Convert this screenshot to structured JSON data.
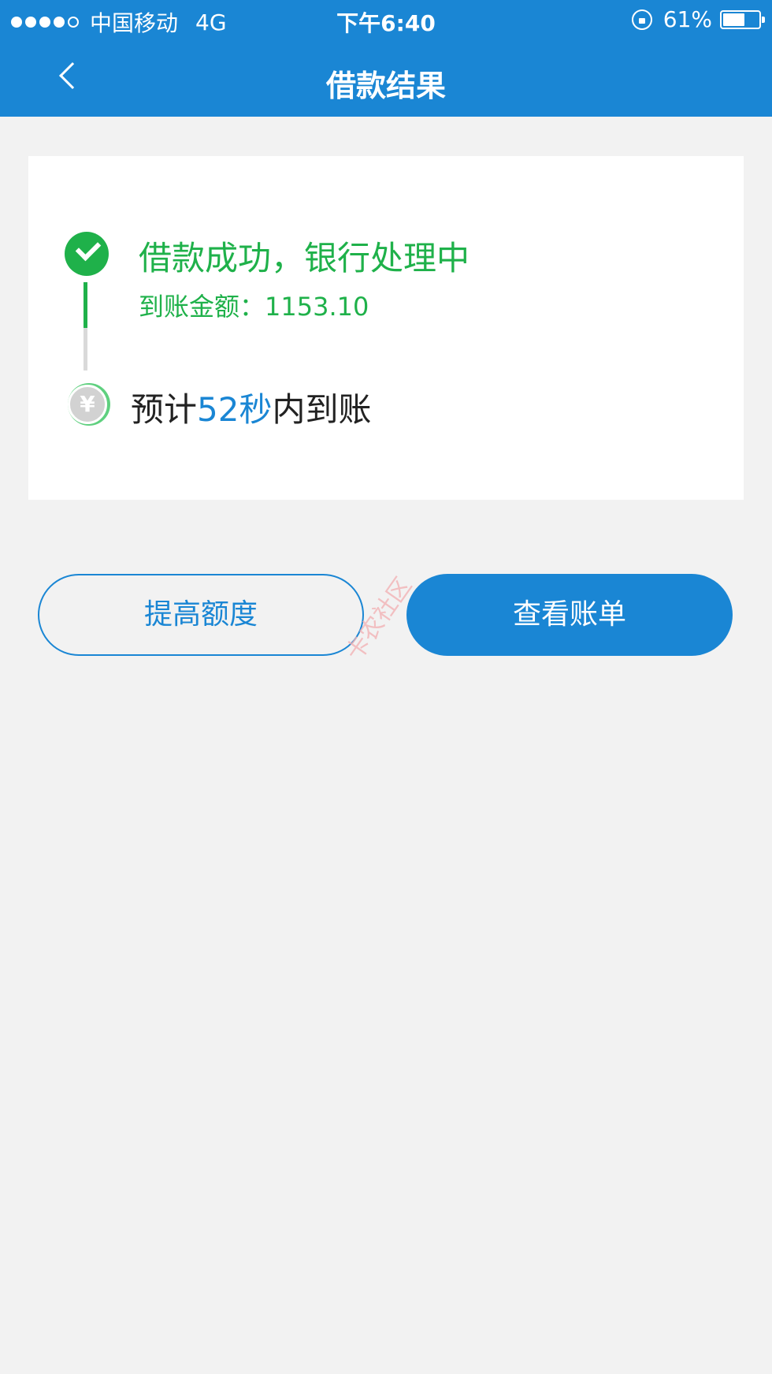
{
  "status_bar": {
    "carrier": "中国移动",
    "network": "4G",
    "time": "下午6:40",
    "battery": "61%",
    "battery_level": 0.61
  },
  "nav": {
    "title": "借款结果"
  },
  "result": {
    "success_title": "借款成功，银行处理中",
    "amount_label": "到账金额：",
    "amount_value": "1153.10",
    "eta_prefix": "预计",
    "eta_value": "52秒",
    "eta_suffix": "内到账",
    "yen_symbol": "¥"
  },
  "actions": {
    "raise_limit_label": "提高额度",
    "view_bill_label": "查看账单"
  },
  "watermark": {
    "text": "卡农社区"
  },
  "colors": {
    "brand_blue": "#1a86d4",
    "success_green": "#1fb14a",
    "background": "#f2f2f2"
  }
}
